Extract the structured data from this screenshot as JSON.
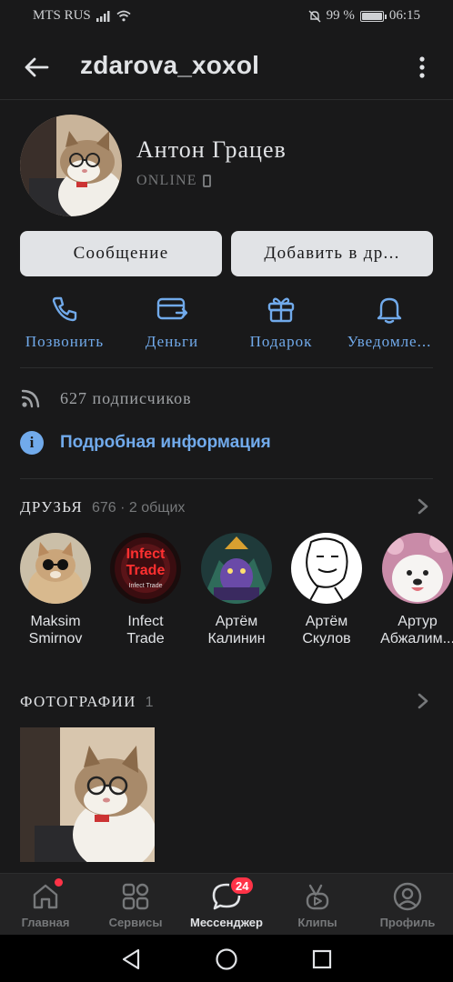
{
  "status_bar": {
    "carrier": "MTS RUS",
    "battery": "99 %",
    "battery_level": 0.99,
    "time": "06:15"
  },
  "header": {
    "title": "zdarova_xoxol",
    "back_icon": "arrow-left-icon",
    "menu_icon": "more-vertical-icon"
  },
  "profile": {
    "name": "Антон Грацев",
    "status": "ONLINE",
    "message_button": "Сообщение",
    "add_friend_button": "Добавить в др..."
  },
  "actions": [
    {
      "label": "Позвонить",
      "icon": "phone-icon"
    },
    {
      "label": "Деньги",
      "icon": "money-card-icon"
    },
    {
      "label": "Подарок",
      "icon": "gift-icon"
    },
    {
      "label": "Уведомле...",
      "icon": "bell-icon"
    }
  ],
  "followers": {
    "text": "627 подписчиков",
    "icon": "rss-icon"
  },
  "details": {
    "label": "Подробная информация",
    "icon": "info-icon"
  },
  "friends": {
    "title": "Друзья",
    "meta": "676 · 2 общих",
    "items": [
      {
        "first": "Maksim",
        "last": "Smirnov"
      },
      {
        "first": "Infect",
        "last": "Trade"
      },
      {
        "first": "Артём",
        "last": "Калинин"
      },
      {
        "first": "Артём",
        "last": "Скулов"
      },
      {
        "first": "Артур",
        "last": "Абжалим..."
      }
    ],
    "infect_logo_line1": "Infect",
    "infect_logo_line2": "Trade",
    "infect_logo_small": "Infect Trade"
  },
  "photos": {
    "title": "Фотографии",
    "count": "1"
  },
  "tabbar": {
    "tabs": [
      {
        "label": "Главная",
        "icon": "home-icon"
      },
      {
        "label": "Сервисы",
        "icon": "services-grid-icon"
      },
      {
        "label": "Мессенджер",
        "icon": "message-bubble-icon",
        "badge": "24"
      },
      {
        "label": "Клипы",
        "icon": "clips-icon"
      },
      {
        "label": "Профиль",
        "icon": "profile-icon"
      }
    ],
    "active": 2
  },
  "colors": {
    "accent": "#71aaeb",
    "background": "#19191a",
    "badge": "#ff3347"
  }
}
